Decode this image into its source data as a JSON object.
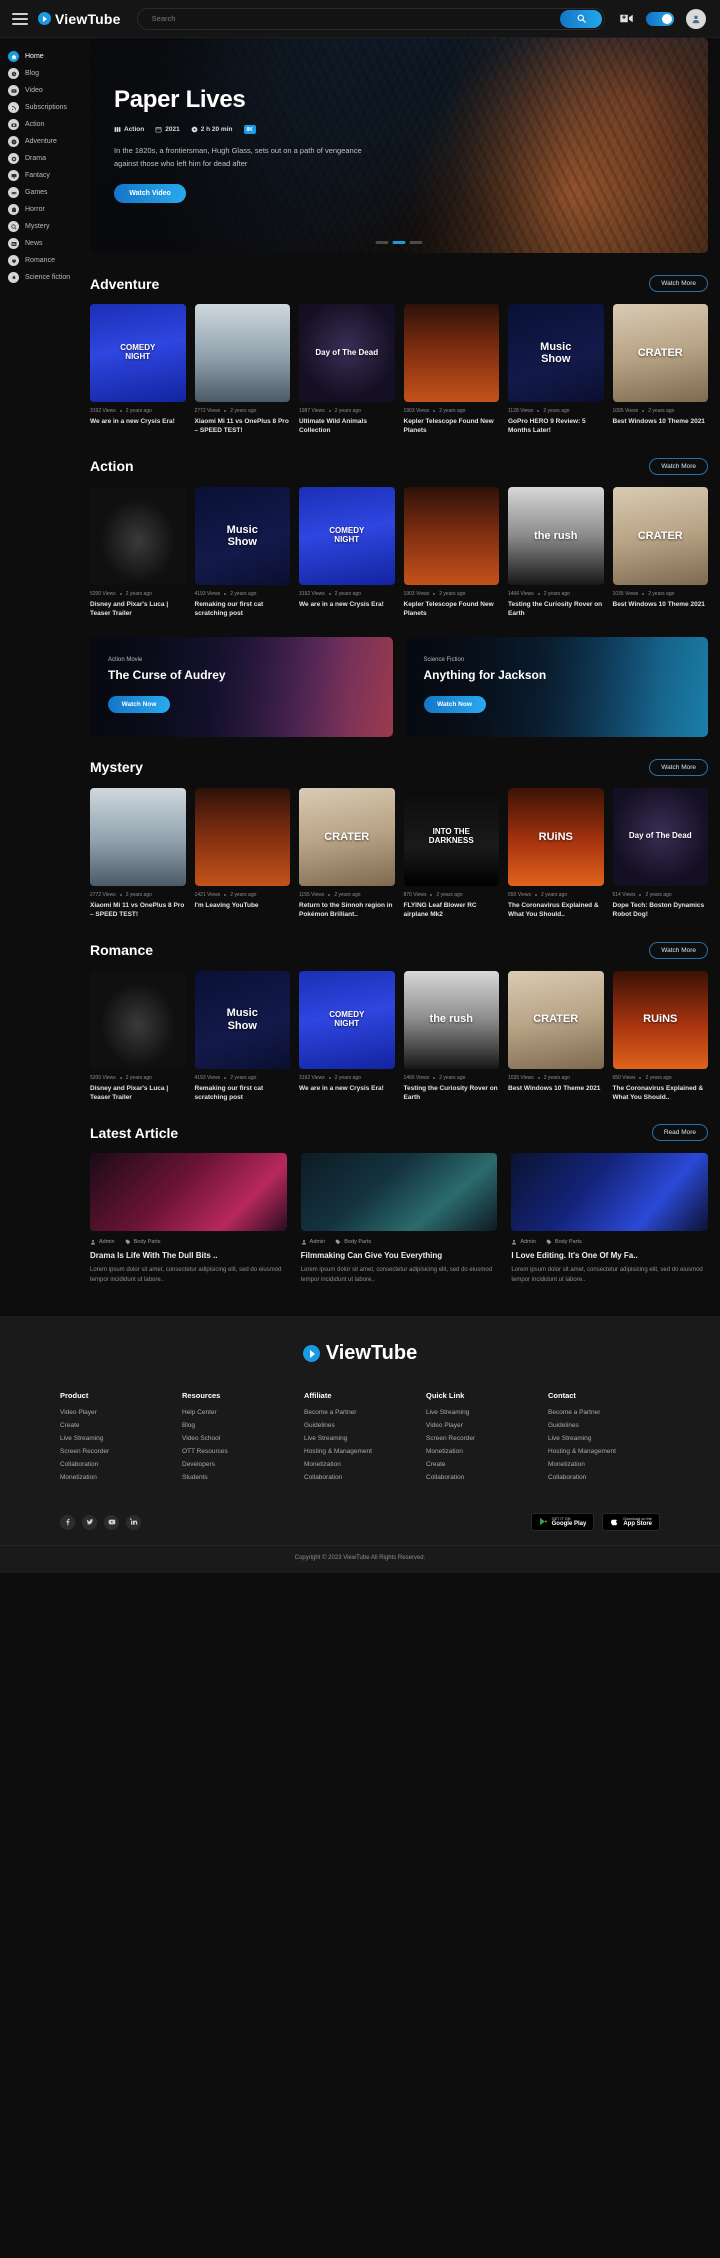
{
  "header": {
    "brand": "ViewTube",
    "search_placeholder": "Search",
    "search_value": "",
    "search_icon": "search-icon",
    "video_icon": "video-add-icon",
    "toggle_state": "on",
    "avatar_icon": "user-avatar-icon",
    "accent": "#1a9ae0"
  },
  "sidebar": {
    "items": [
      {
        "label": "Home",
        "icon": "home-icon",
        "active": true
      },
      {
        "label": "Blog",
        "icon": "blog-icon",
        "active": false
      },
      {
        "label": "Video",
        "icon": "video-icon",
        "active": false
      },
      {
        "label": "Subscriptions",
        "icon": "rss-icon",
        "active": false
      },
      {
        "label": "Action",
        "icon": "camera-icon",
        "active": false
      },
      {
        "label": "Adventure",
        "icon": "compass-icon",
        "active": false
      },
      {
        "label": "Drama",
        "icon": "mask-icon",
        "active": false
      },
      {
        "label": "Fantacy",
        "icon": "monitor-icon",
        "active": false
      },
      {
        "label": "Games",
        "icon": "gamepad-icon",
        "active": false
      },
      {
        "label": "Horror",
        "icon": "ghost-icon",
        "active": false
      },
      {
        "label": "Mystery",
        "icon": "magnify-icon",
        "active": false
      },
      {
        "label": "News",
        "icon": "news-icon",
        "active": false
      },
      {
        "label": "Romance",
        "icon": "heart-icon",
        "active": false
      },
      {
        "label": "Science fiction",
        "icon": "rocket-icon",
        "active": false
      }
    ]
  },
  "hero": {
    "title": "Paper Lives",
    "genre": "Action",
    "year": "2021",
    "duration": "2 h 20 min",
    "quality": "8K",
    "description": "In the 1820s, a frontiersman, Hugh Glass, sets out on a path of vengeance against those who left him for dead after",
    "button": "Watch Video",
    "slides": 4,
    "active_slide": 2
  },
  "sections": [
    {
      "title": "Adventure",
      "action": "Watch More",
      "cards": [
        {
          "views": "3192 Views",
          "age": "2 years ago",
          "title": "We are in a new Crysis Era!",
          "art": "p-comedy",
          "art_text": "COMEDY\nNIGHT"
        },
        {
          "views": "2772 Views",
          "age": "2 years ago",
          "title": "Xiaomi Mi 11 vs OnePlus 8 Pro – SPEED TEST!",
          "art": "p-snow",
          "art_text": ""
        },
        {
          "views": "1987 Views",
          "age": "2 years ago",
          "title": "Ultimate Wild Animals Collection",
          "art": "p-dead",
          "art_text": "Day of The Dead"
        },
        {
          "views": "1903 Views",
          "age": "2 years ago",
          "title": "Kepler Telescope Found New Planets",
          "art": "p-fire",
          "art_text": ""
        },
        {
          "views": "1128 Views",
          "age": "2 years ago",
          "title": "GoPro HERO 9 Review: 5 Months Later!",
          "art": "p-music",
          "art_text": "Music\nShow"
        },
        {
          "views": "1095 Views",
          "age": "2 years ago",
          "title": "Best Windows 10 Theme 2021",
          "art": "p-crater",
          "art_text": "CRATER"
        }
      ]
    },
    {
      "title": "Action",
      "action": "Watch More",
      "cards": [
        {
          "views": "5200 Views",
          "age": "2 years ago",
          "title": "Disney and Pixar's Luca | Teaser Trailer",
          "art": "p-moon",
          "art_text": ""
        },
        {
          "views": "4193 Views",
          "age": "2 years ago",
          "title": "Remaking our first cat scratching post",
          "art": "p-music",
          "art_text": "Music\nShow"
        },
        {
          "views": "3192 Views",
          "age": "2 years ago",
          "title": "We are in a new Crysis Era!",
          "art": "p-comedy",
          "art_text": "COMEDY\nNIGHT"
        },
        {
          "views": "1903 Views",
          "age": "2 years ago",
          "title": "Kepler Telescope Found New Planets",
          "art": "p-fire",
          "art_text": ""
        },
        {
          "views": "1466 Views",
          "age": "2 years ago",
          "title": "Testing the Curiosity Rover on Earth",
          "art": "p-rush",
          "art_text": "the rush"
        },
        {
          "views": "1035 Views",
          "age": "2 years ago",
          "title": "Best Windows 10 Theme 2021",
          "art": "p-crater",
          "art_text": "CRATER"
        }
      ]
    },
    {
      "title": "Mystery",
      "action": "Watch More",
      "cards": [
        {
          "views": "2772 Views",
          "age": "2 years ago",
          "title": "Xiaomi Mi 11 vs OnePlus 8 Pro – SPEED TEST!",
          "art": "p-snow",
          "art_text": ""
        },
        {
          "views": "1421 Views",
          "age": "2 years ago",
          "title": "I'm Leaving YouTube",
          "art": "p-fire",
          "art_text": ""
        },
        {
          "views": "1155 Views",
          "age": "2 years ago",
          "title": "Return to the Sinnoh region in Pokémon Brilliant..",
          "art": "p-crater",
          "art_text": "CRATER"
        },
        {
          "views": "870 Views",
          "age": "2 years ago",
          "title": "FLYING Leaf Blower RC airplane Mk2",
          "art": "p-dark",
          "art_text": "INTO THE\nDARKNESS"
        },
        {
          "views": "650 Views",
          "age": "2 years ago",
          "title": "The Coronavirus Explained & What You Should..",
          "art": "p-ruins",
          "art_text": "RUiNS"
        },
        {
          "views": "514 Views",
          "age": "2 years ago",
          "title": "Dope Tech: Boston Dynamics Robot Dog!",
          "art": "p-dead",
          "art_text": "Day of The Dead"
        }
      ]
    },
    {
      "title": "Romance",
      "action": "Watch More",
      "cards": [
        {
          "views": "5200 Views",
          "age": "2 years ago",
          "title": "Disney and Pixar's Luca | Teaser Trailer",
          "art": "p-moon",
          "art_text": ""
        },
        {
          "views": "4193 Views",
          "age": "2 years ago",
          "title": "Remaking our first cat scratching post",
          "art": "p-music",
          "art_text": "Music\nShow"
        },
        {
          "views": "3192 Views",
          "age": "2 years ago",
          "title": "We are in a new Crysis Era!",
          "art": "p-comedy",
          "art_text": "COMEDY\nNIGHT"
        },
        {
          "views": "1466 Views",
          "age": "2 years ago",
          "title": "Testing the Curiosity Rover on Earth",
          "art": "p-rush",
          "art_text": "the rush"
        },
        {
          "views": "1035 Views",
          "age": "2 years ago",
          "title": "Best Windows 10 Theme 2021",
          "art": "p-crater",
          "art_text": "CRATER"
        },
        {
          "views": "650 Views",
          "age": "2 years ago",
          "title": "The Coronavirus Explained & What You Should..",
          "art": "p-ruins",
          "art_text": "RUiNS"
        }
      ]
    }
  ],
  "features": [
    {
      "kicker": "Action Movie",
      "title": "The Curse of Audrey",
      "button": "Watch Now",
      "theme": "feat-a"
    },
    {
      "kicker": "Science Fiction",
      "title": "Anything for Jackson",
      "button": "Watch Now",
      "theme": "feat-b"
    }
  ],
  "articles": {
    "title": "Latest Article",
    "action": "Read More",
    "items": [
      {
        "author": "Admin",
        "category": "Body Parts",
        "title": "Drama Is Life With The Dull Bits ..",
        "excerpt": "Lorem ipsum dolor sit amet, consectetur adipisicing elit, sed do eiusmod tempor incididunt ut labore..",
        "art": "at1"
      },
      {
        "author": "Admin",
        "category": "Body Parts",
        "title": "Filmmaking Can Give You Everything",
        "excerpt": "Lorem ipsum dolor sit amet, consectetur adipisicing elit, sed do eiusmod tempor incididunt ut labore..",
        "art": "at2"
      },
      {
        "author": "Admin",
        "category": "Body Parts",
        "title": "I Love Editing. It's One Of My Fa..",
        "excerpt": "Lorem ipsum dolor sit amet, consectetur adipisicing elit, sed do eiusmod tempor incididunt ut labore..",
        "art": "at3"
      }
    ]
  },
  "footer": {
    "brand": "ViewTube",
    "columns": [
      {
        "heading": "Product",
        "links": [
          "Video Player",
          "Create",
          "Live Streaming",
          "Screen Recorder",
          "Collaboration",
          "Monetization"
        ]
      },
      {
        "heading": "Resources",
        "links": [
          "Help Center",
          "Blog",
          "Video School",
          "OTT Resources",
          "Developers",
          "Students"
        ]
      },
      {
        "heading": "Affiliate",
        "links": [
          "Become a Partner",
          "Guidelines",
          "Live Streaming",
          "Hosting & Management",
          "Monetization",
          "Collaboration"
        ]
      },
      {
        "heading": "Quick Link",
        "links": [
          "Live Streaming",
          "Video Player",
          "Screen Recorder",
          "Monetization",
          "Create",
          "Collaboration"
        ]
      },
      {
        "heading": "Contact",
        "links": [
          "Become a Partner",
          "Guidelines",
          "Live Streaming",
          "Hosting & Management",
          "Monetization",
          "Collaboration"
        ]
      }
    ],
    "socials": [
      "facebook-icon",
      "twitter-icon",
      "youtube-icon",
      "linkedin-icon"
    ],
    "stores": [
      {
        "small": "GET IT ON",
        "big": "Google Play",
        "icon": "google-play-icon"
      },
      {
        "small": "Download on the",
        "big": "App Store",
        "icon": "apple-icon"
      }
    ],
    "copyright": "Copyright © 2023 ViewTube All Rights Reserved."
  }
}
